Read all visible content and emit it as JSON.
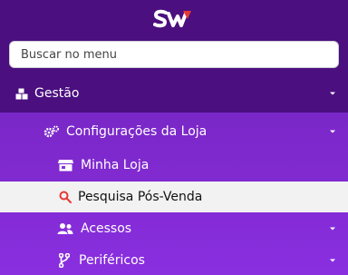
{
  "logo": {
    "text": "SW"
  },
  "search": {
    "placeholder": "Buscar no menu"
  },
  "menu": {
    "gestao": {
      "label": "Gestão",
      "icon": "boxes-icon"
    },
    "configuracoes": {
      "label": "Configurações da Loja",
      "icon": "gears-icon"
    },
    "minha_loja": {
      "label": "Minha Loja",
      "icon": "store-icon"
    },
    "pesquisa": {
      "label": "Pesquisa Pós-Venda",
      "icon": "search-icon"
    },
    "acessos": {
      "label": "Acessos",
      "icon": "users-icon"
    },
    "perifericos": {
      "label": "Periféricos",
      "icon": "code-branch-icon"
    }
  },
  "colors": {
    "sidebar_bg": "#4b0f80",
    "submenu_bg": "#8a2fe0",
    "active_bg": "#f2f2f2",
    "accent_red": "#e53935"
  }
}
